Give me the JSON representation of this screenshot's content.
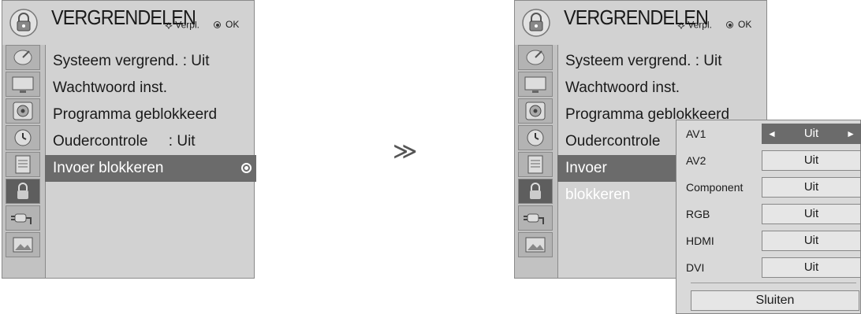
{
  "menu_title": "VERGRENDELEN",
  "hint_move": "Verpl.",
  "hint_ok": "OK",
  "items": [
    "Systeem vergrend. : Uit",
    "Wachtwoord inst.",
    "Programma geblokkeerd",
    "Oudercontrole     : Uit",
    "Invoer blokkeren"
  ],
  "items_right": [
    "Systeem vergrend. : Uit",
    "Wachtwoord inst.",
    "Programma geblokkeerd",
    "Oudercontrole",
    "Invoer blokkeren"
  ],
  "sidebar_icons": [
    "satellite-dish-icon",
    "monitor-icon",
    "speaker-icon",
    "clock-icon",
    "document-icon",
    "lock-icon",
    "plug-icon",
    "picture-icon"
  ],
  "transition_symbol": "≫",
  "popup": {
    "rows": [
      {
        "label": "AV1",
        "value": "Uit",
        "active": true
      },
      {
        "label": "AV2",
        "value": "Uit",
        "active": false
      },
      {
        "label": "Component",
        "value": "Uit",
        "active": false
      },
      {
        "label": "RGB",
        "value": "Uit",
        "active": false
      },
      {
        "label": "HDMI",
        "value": "Uit",
        "active": false
      },
      {
        "label": "DVI",
        "value": "Uit",
        "active": false
      }
    ],
    "close_label": "Sluiten"
  }
}
